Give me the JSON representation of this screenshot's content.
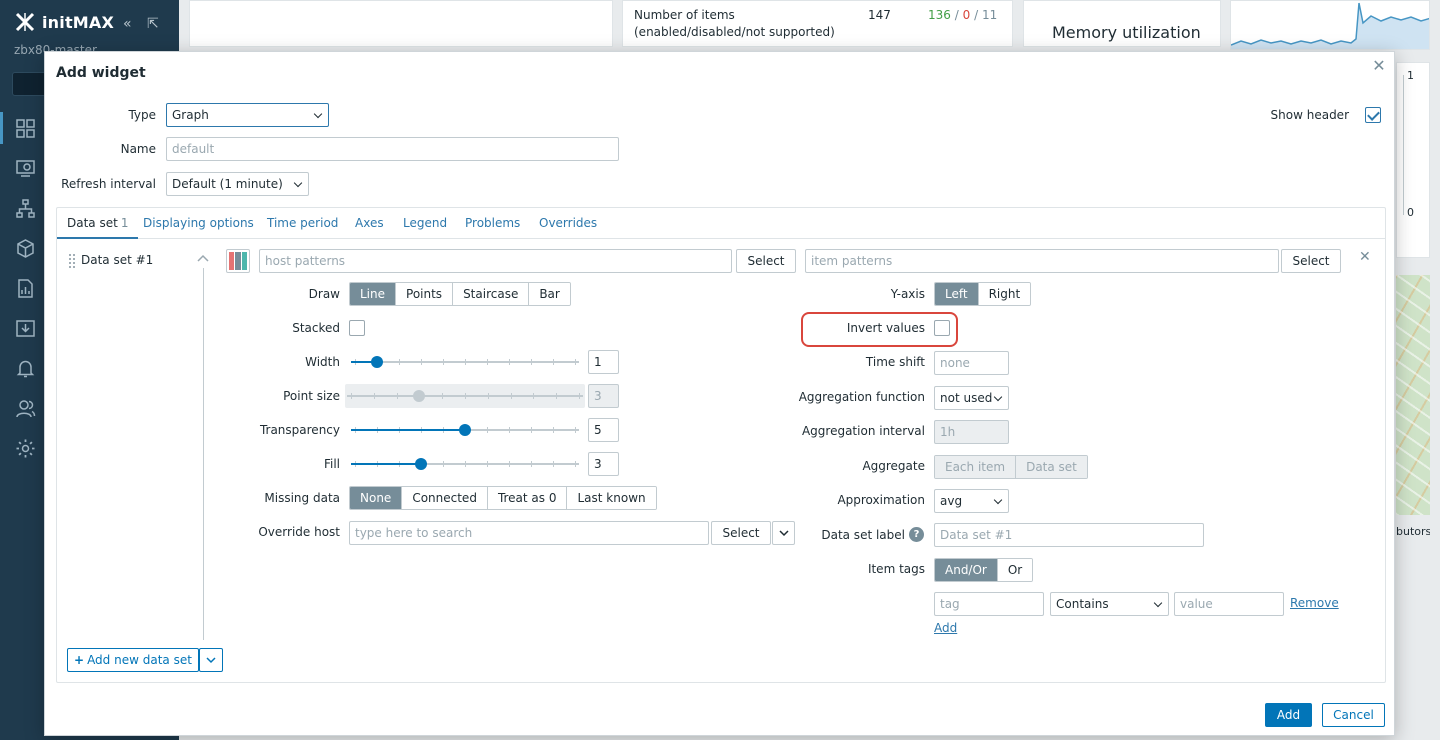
{
  "app": {
    "brand": "initMAX",
    "server": "zbx80-master"
  },
  "sidebar": {
    "icons": [
      "dashboard-icon",
      "monitoring-icon",
      "network-icon",
      "inventory-icon",
      "reports-icon",
      "data-collection-icon",
      "alerts-icon",
      "users-icon",
      "settings-icon"
    ]
  },
  "background": {
    "items_label": "Number of items (enabled/disabled/not supported)",
    "items_total": "147",
    "items_enabled": "136",
    "items_sep1": "/",
    "items_disabled": "0",
    "items_sep2": "/",
    "items_unsupported": "11",
    "memory_title": "Memory utilization",
    "axis_max": "1",
    "axis_min": "0",
    "map_footer": "butors"
  },
  "dialog": {
    "title": "Add widget",
    "type_label": "Type",
    "type_value": "Graph",
    "show_header_label": "Show header",
    "name_label": "Name",
    "name_placeholder": "default",
    "refresh_label": "Refresh interval",
    "refresh_value": "Default (1 minute)",
    "tabs": [
      {
        "label": "Data set",
        "count": "1"
      },
      {
        "label": "Displaying options"
      },
      {
        "label": "Time period"
      },
      {
        "label": "Axes"
      },
      {
        "label": "Legend"
      },
      {
        "label": "Problems"
      },
      {
        "label": "Overrides"
      }
    ],
    "dataset": {
      "name": "Data set #1",
      "host_placeholder": "host patterns",
      "item_placeholder": "item patterns",
      "select_label": "Select",
      "draw_label": "Draw",
      "draw_options": [
        "Line",
        "Points",
        "Staircase",
        "Bar"
      ],
      "stacked_label": "Stacked",
      "width_label": "Width",
      "width_value": "1",
      "point_size_label": "Point size",
      "point_size_value": "3",
      "transparency_label": "Transparency",
      "transparency_value": "5",
      "fill_label": "Fill",
      "fill_value": "3",
      "missing_label": "Missing data",
      "missing_options": [
        "None",
        "Connected",
        "Treat as 0",
        "Last known"
      ],
      "override_label": "Override host",
      "override_placeholder": "type here to search",
      "yaxis_label": "Y-axis",
      "yaxis_options": [
        "Left",
        "Right"
      ],
      "invert_label": "Invert values",
      "timeshift_label": "Time shift",
      "timeshift_placeholder": "none",
      "aggfunc_label": "Aggregation function",
      "aggfunc_value": "not used",
      "agginterval_label": "Aggregation interval",
      "agginterval_placeholder": "1h",
      "aggregate_label": "Aggregate",
      "aggregate_options": [
        "Each item",
        "Data set"
      ],
      "approx_label": "Approximation",
      "approx_value": "avg",
      "dslabel_label": "Data set label",
      "dslabel_placeholder": "Data set #1",
      "help_glyph": "?",
      "itemtags_label": "Item tags",
      "itemtags_options": [
        "And/Or",
        "Or"
      ],
      "tag_placeholder": "tag",
      "operator_value": "Contains",
      "value_placeholder": "value",
      "remove_label": "Remove",
      "add_tag_label": "Add"
    },
    "add_dataset_label": "Add new data set",
    "add_button": "Add",
    "cancel_button": "Cancel",
    "colors": {
      "accent": "#0275b8",
      "highlight": "#d9463c",
      "swatch": [
        "#e57373",
        "#768d99",
        "#4db6ac"
      ]
    }
  }
}
